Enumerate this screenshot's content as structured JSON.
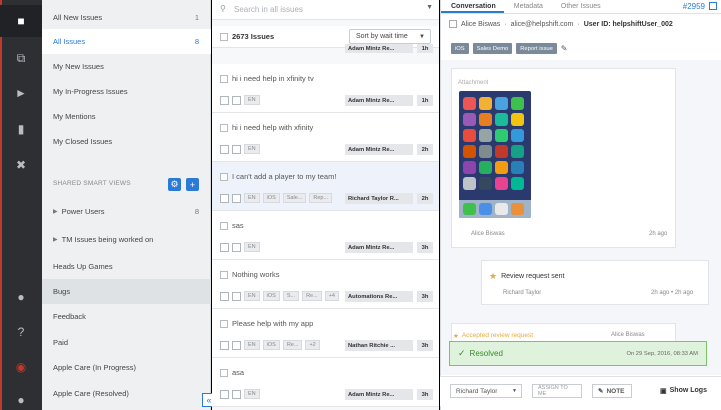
{
  "rail": {
    "icons": [
      "chat-icon",
      "copy-icon",
      "megaphone-icon",
      "bar-chart-icon",
      "tools-icon",
      "bell-icon",
      "help-icon",
      "eye-icon",
      "user-icon"
    ]
  },
  "filters": {
    "items": [
      {
        "label": "All New Issues",
        "count": "1"
      },
      {
        "label": "All Issues",
        "count": "8"
      },
      {
        "label": "My New Issues",
        "count": ""
      },
      {
        "label": "My In-Progress Issues",
        "count": ""
      },
      {
        "label": "My Mentions",
        "count": ""
      },
      {
        "label": "My Closed Issues",
        "count": ""
      }
    ],
    "shared_header": "SHARED SMART VIEWS",
    "shared_items": [
      {
        "label": "Power Users",
        "count": "8"
      },
      {
        "label": "TM Issues being worked on",
        "count": ""
      },
      {
        "label": "Heads Up Games",
        "count": ""
      },
      {
        "label": "Bugs",
        "count": ""
      },
      {
        "label": "Feedback",
        "count": ""
      },
      {
        "label": "Paid",
        "count": ""
      },
      {
        "label": "Apple Care (In Progress)",
        "count": ""
      },
      {
        "label": "Apple Care (Resolved)",
        "count": ""
      }
    ]
  },
  "list": {
    "search_placeholder": "Search in all issues",
    "count_label": "2673 Issues",
    "sort_label": "Sort by wait time",
    "top_agent": "Adam Mintz Re...",
    "top_time": "1h",
    "issues": [
      {
        "title": "hi i need help in xfinity tv",
        "tags": [
          "EN"
        ],
        "agent": "Adam Mintz Re...",
        "time": "1h",
        "selected": false
      },
      {
        "title": "hi i need help with xfinity",
        "tags": [
          "EN"
        ],
        "agent": "Adam Mintz Re...",
        "time": "2h",
        "selected": false
      },
      {
        "title": "I can't add a player to my team!",
        "tags": [
          "EN",
          "iOS",
          "Sale...",
          "Rep..."
        ],
        "agent": "Richard Taylor R...",
        "time": "2h",
        "selected": true
      },
      {
        "title": "sas",
        "tags": [
          "EN"
        ],
        "agent": "Adam Mintz Re...",
        "time": "3h",
        "selected": false
      },
      {
        "title": "Nothing works",
        "tags": [
          "EN",
          "iOS",
          "S...",
          "Re...",
          "+4"
        ],
        "agent": "Automations Re...",
        "time": "3h",
        "selected": false
      },
      {
        "title": "Please help with my app",
        "tags": [
          "EN",
          "iOS",
          "Re...",
          "+2"
        ],
        "agent": "Nathan Ritchie ...",
        "time": "3h",
        "selected": false
      },
      {
        "title": "asa",
        "tags": [
          "EN"
        ],
        "agent": "Adam Mintz Re...",
        "time": "3h",
        "selected": false
      }
    ]
  },
  "conversation": {
    "tabs": [
      "Conversation",
      "Metadata",
      "Other Issues"
    ],
    "issue_id": "#2959",
    "customer_name": "Alice Biswas",
    "customer_email": "alice@helpshift.com",
    "user_id_label": "User ID: helpshiftUser_002",
    "tags": [
      "iOS",
      "Sales Demo",
      "Report issue"
    ],
    "attachment_label": "Attachment",
    "attachment_author": "Alice Biswas",
    "attachment_time": "2h ago",
    "review_label": "Review request sent",
    "review_author": "Richard Taylor",
    "review_time": "2h ago • 2h ago",
    "accepted_label": "Accepted review request",
    "accepted_author": "Alice Biswas",
    "resolved_label": "Resolved",
    "resolved_time": "On 29 Sep, 2016, 08:33 AM",
    "assignee": "Richard Taylor",
    "assign_to_me": "ASSIGN TO ME",
    "note_label": "NOTE",
    "show_logs": "Show Logs"
  }
}
